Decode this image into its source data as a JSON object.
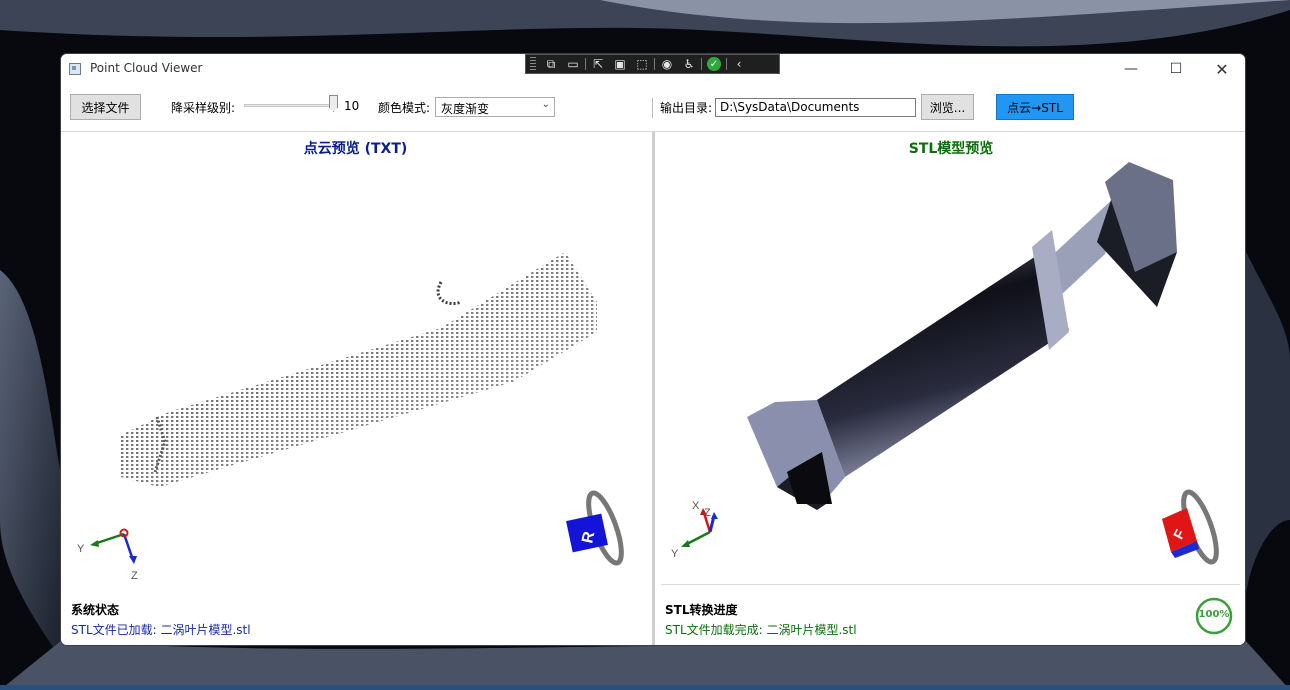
{
  "window": {
    "title": "Point Cloud Viewer",
    "minimize": "—",
    "maximize": "☐",
    "close": "✕"
  },
  "toolbar": {
    "select_file": "选择文件",
    "downsample_label": "降采样级别:",
    "downsample_value": "10",
    "color_mode_label": "颜色模式:",
    "color_mode_value": "灰度渐变",
    "output_dir_label": "输出目录:",
    "output_dir_value": "D:\\SysData\\Documents",
    "browse": "浏览...",
    "convert": "点云→STL"
  },
  "left_panel": {
    "title": "点云预览 (TXT)",
    "axis_y": "Y",
    "axis_z": "Z",
    "cube_face": "R",
    "status_title": "系统状态",
    "status_text": "STL文件已加载: 二涡叶片模型.stl"
  },
  "right_panel": {
    "title": "STL模型预览",
    "axis_x": "X",
    "axis_y": "Y",
    "axis_z": "Z",
    "cube_face": "F",
    "status_title": "STL转换进度",
    "status_text": "STL文件加载完成: 二涡叶片模型.stl",
    "progress": "100%",
    "progress_fraction": 1.0
  },
  "debug_toolbar": {
    "icons": [
      "grip-icon",
      "live-tree-icon",
      "camera-icon",
      "select-element-icon",
      "display-layout-icon",
      "track-focus-icon",
      "hot-reload-icon",
      "accessibility-icon",
      "check-icon",
      "collapse-icon"
    ]
  },
  "colors": {
    "accent_button": "#2196f3",
    "left_title": "#0b1f8c",
    "right_title": "#0d6e0d",
    "progress": "#3aa03a"
  }
}
